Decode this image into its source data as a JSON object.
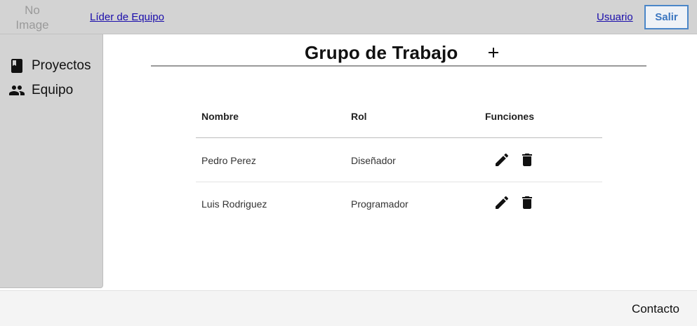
{
  "header": {
    "logo_text": "No Image",
    "role_link": "Líder de Equipo",
    "user_link": "Usuario",
    "logout_button": "Salir"
  },
  "sidebar": {
    "items": [
      {
        "label": "Proyectos",
        "icon": "book-icon"
      },
      {
        "label": "Equipo",
        "icon": "people-icon"
      }
    ]
  },
  "main": {
    "title": "Grupo de Trabajo",
    "add_icon": "plus-icon",
    "table": {
      "columns": [
        "Nombre",
        "Rol",
        "Funciones"
      ],
      "rows": [
        {
          "nombre": "Pedro Perez",
          "rol": "Diseñador",
          "actions": [
            "edit-icon",
            "trash-icon"
          ]
        },
        {
          "nombre": "Luis Rodriguez",
          "rol": "Programador",
          "actions": [
            "edit-icon",
            "trash-icon"
          ]
        }
      ]
    }
  },
  "footer": {
    "contact_link": "Contacto"
  },
  "colors": {
    "topbar_bg": "#d3d3d3",
    "sidebar_bg": "#d3d3d3",
    "footer_bg": "#f4f4f4",
    "logout_accent": "#3b76c0",
    "link_color": "#1a0dab"
  }
}
